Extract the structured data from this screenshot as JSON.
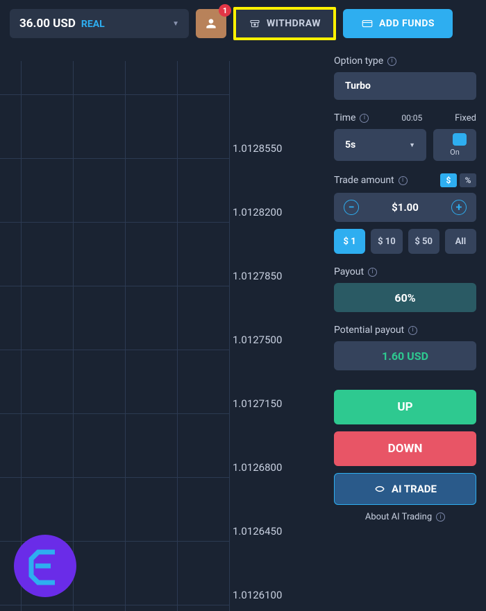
{
  "topbar": {
    "balance_amount": "36.00 USD",
    "balance_label": "REAL",
    "notifications": "1",
    "withdraw_label": "WITHDRAW",
    "add_funds_label": "ADD FUNDS"
  },
  "chart_data": {
    "type": "line",
    "y_ticks": [
      1.012855,
      1.01282,
      1.012785,
      1.01275,
      1.012715,
      1.01268,
      1.012645,
      1.01261
    ],
    "y_tick_labels": [
      "1.0128550",
      "1.0128200",
      "1.0127850",
      "1.0127500",
      "1.0127150",
      "1.0126800",
      "1.0126450",
      "1.0126100"
    ],
    "ylim": [
      1.01261,
      1.01289
    ],
    "grid": true,
    "series": []
  },
  "sidepanel": {
    "option_type": {
      "label": "Option type",
      "value": "Turbo"
    },
    "time": {
      "label": "Time",
      "countdown": "00:05",
      "fixed_label": "Fixed",
      "value": "5s",
      "fixed_state": "On"
    },
    "trade_amount": {
      "label": "Trade amount",
      "currency_symbol": "$",
      "percent_symbol": "%",
      "value": "$1.00",
      "presets": [
        "$ 1",
        "$ 10",
        "$ 50",
        "All"
      ],
      "active_preset": 0
    },
    "payout": {
      "label": "Payout",
      "value": "60%"
    },
    "potential": {
      "label": "Potential payout",
      "value": "1.60 USD"
    },
    "buttons": {
      "up": "UP",
      "down": "DOWN",
      "ai": "AI TRADE",
      "about": "About AI Trading"
    }
  }
}
